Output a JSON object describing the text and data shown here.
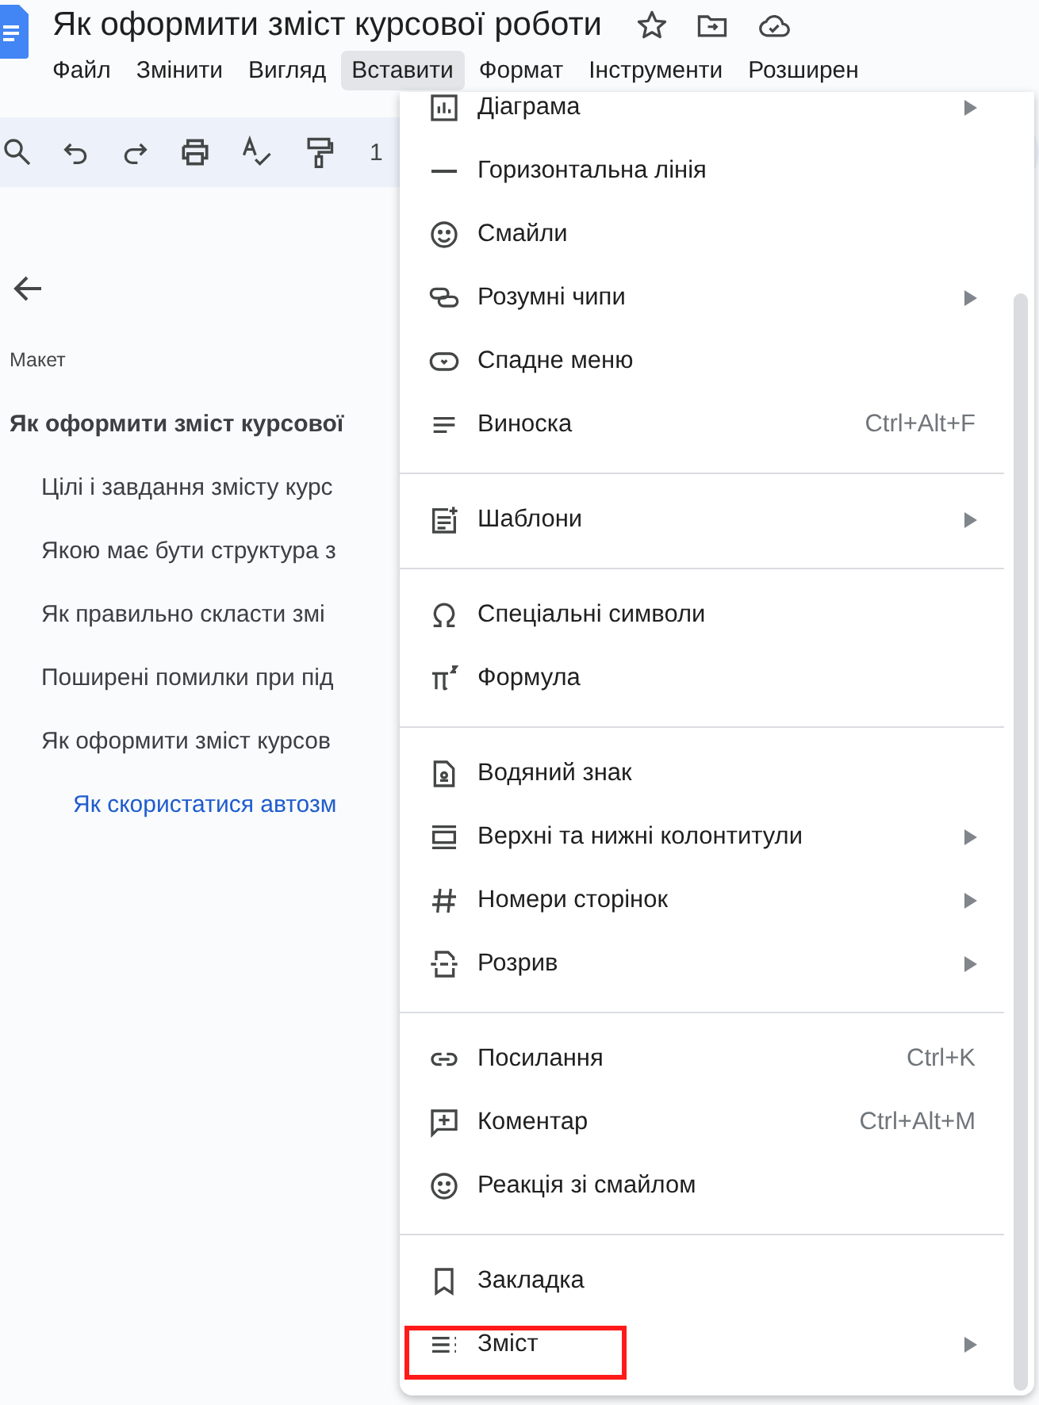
{
  "document": {
    "title": "Як оформити зміст курсової роботи"
  },
  "menubar": [
    {
      "label": "Файл",
      "selected": false
    },
    {
      "label": "Змінити",
      "selected": false
    },
    {
      "label": "Вигляд",
      "selected": false
    },
    {
      "label": "Вставити",
      "selected": true
    },
    {
      "label": "Формат",
      "selected": false
    },
    {
      "label": "Інструменти",
      "selected": false
    },
    {
      "label": "Розширен",
      "selected": false
    }
  ],
  "toolbar": {
    "zoom": "1"
  },
  "outline": {
    "label": "Макет",
    "headings": [
      {
        "text": "Як оформити зміст курсової",
        "selected": false,
        "children": [
          {
            "text": "Цілі і завдання змісту курс",
            "selected": false
          },
          {
            "text": "Якою має бути структура з",
            "selected": false
          },
          {
            "text": "Як правильно скласти змі",
            "selected": false
          },
          {
            "text": "Поширені помилки при під",
            "selected": false
          },
          {
            "text": "Як оформити зміст курсов",
            "selected": false,
            "children": [
              {
                "text": "Як скористатися автозм",
                "selected": true
              }
            ]
          }
        ]
      }
    ]
  },
  "menu": {
    "sections": [
      {
        "items": [
          {
            "label": "Діаграма",
            "submenu": true,
            "marked": false
          },
          {
            "label": "Горизонтальна лінія",
            "submenu": false,
            "marked": false
          },
          {
            "label": "Смайли",
            "submenu": false,
            "marked": false
          },
          {
            "label": "Розумні чипи",
            "submenu": true,
            "marked": false
          },
          {
            "label": "Спадне меню",
            "submenu": false,
            "marked": false
          },
          {
            "label": "Виноска",
            "shortcut": "Ctrl+Alt+F",
            "submenu": false,
            "marked": false
          }
        ]
      },
      {
        "items": [
          {
            "label": "Шаблони",
            "submenu": true,
            "marked": false
          }
        ]
      },
      {
        "items": [
          {
            "label": "Спеціальні символи",
            "submenu": false,
            "marked": false
          },
          {
            "label": "Формула",
            "submenu": false,
            "marked": false
          }
        ]
      },
      {
        "items": [
          {
            "label": "Водяний знак",
            "submenu": false,
            "marked": false
          },
          {
            "label": "Верхні та нижні колонтитули",
            "submenu": true,
            "marked": false
          },
          {
            "label": "Номери сторінок",
            "submenu": true,
            "marked": false
          },
          {
            "label": "Розрив",
            "submenu": true,
            "marked": false
          }
        ]
      },
      {
        "items": [
          {
            "label": "Посилання",
            "shortcut": "Ctrl+K",
            "submenu": false,
            "marked": false
          },
          {
            "label": "Коментар",
            "shortcut": "Ctrl+Alt+M",
            "submenu": false,
            "marked": false
          },
          {
            "label": "Реакція зі смайлом",
            "submenu": false,
            "marked": false
          }
        ]
      },
      {
        "items": [
          {
            "label": "Закладка",
            "submenu": false,
            "marked": false
          },
          {
            "label": "Зміст",
            "submenu": true,
            "marked": true
          }
        ]
      }
    ]
  }
}
